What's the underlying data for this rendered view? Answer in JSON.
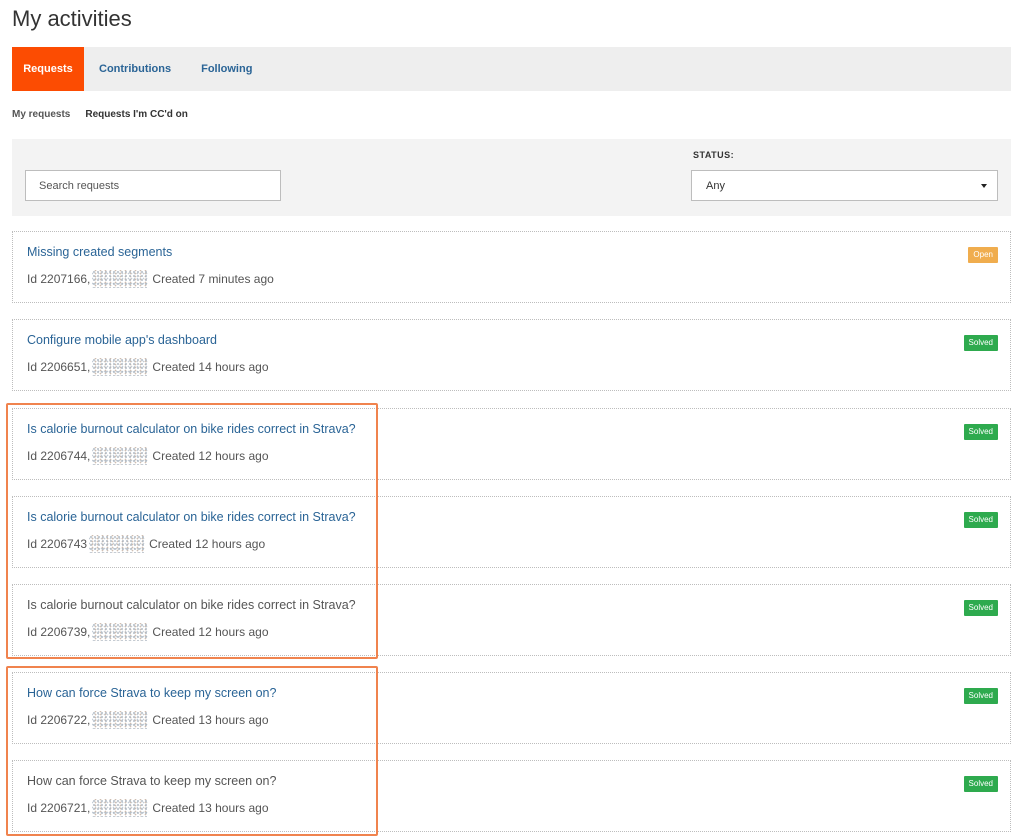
{
  "page": {
    "title": "My activities"
  },
  "tabs": [
    {
      "label": "Requests",
      "active": true
    },
    {
      "label": "Contributions",
      "active": false
    },
    {
      "label": "Following",
      "active": false
    }
  ],
  "subnav": [
    {
      "label": "My requests"
    },
    {
      "label": "Requests I'm CC'd on"
    }
  ],
  "filters": {
    "search_placeholder": "Search requests",
    "status_label": "STATUS:",
    "status_value": "Any"
  },
  "requests": [
    {
      "title": "Missing created segments",
      "id_text": "Id 2207166,",
      "created": "Created 7 minutes ago",
      "status": "Open"
    },
    {
      "title": "Configure mobile app's dashboard",
      "id_text": "Id 2206651,",
      "created": "Created 14 hours ago",
      "status": "Solved"
    },
    {
      "title": "Is calorie burnout calculator on bike rides correct in Strava?",
      "id_text": "Id 2206744,",
      "created": "Created 12 hours ago",
      "status": "Solved"
    },
    {
      "title": "Is calorie burnout calculator on bike rides correct in Strava?",
      "id_text": "Id 2206743",
      "created": "Created 12 hours ago",
      "status": "Solved"
    },
    {
      "title": "Is calorie burnout calculator on bike rides correct in Strava?",
      "id_text": "Id 2206739,",
      "created": "Created 12 hours ago",
      "status": "Solved"
    },
    {
      "title": "How can force Strava to keep my screen on?",
      "id_text": "Id 2206722,",
      "created": "Created 13 hours ago",
      "status": "Solved"
    },
    {
      "title": "How can force Strava to keep my screen on?",
      "id_text": "Id 2206721,",
      "created": "Created 13 hours ago",
      "status": "Solved"
    }
  ],
  "colors": {
    "brand_orange": "#fc4c02",
    "link_blue": "#2a6496",
    "open_badge": "#f0ad4e",
    "solved_badge": "#2eaa4e",
    "highlight_outline": "#f0834e"
  }
}
